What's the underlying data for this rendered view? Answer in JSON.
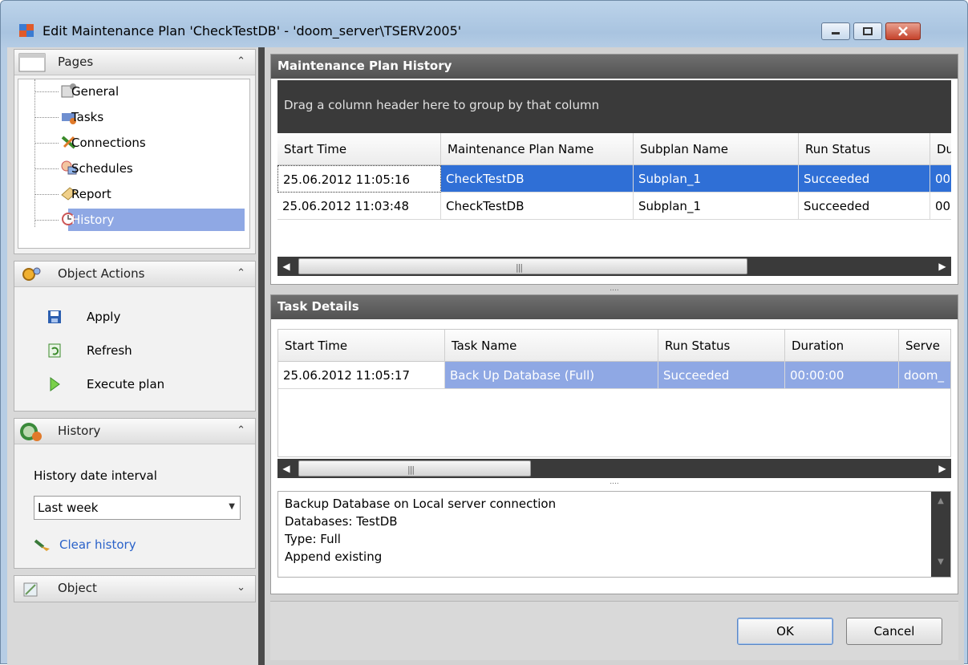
{
  "window": {
    "title": "Edit Maintenance Plan 'CheckTestDB' - 'doom_server\\TSERV2005'"
  },
  "left": {
    "pages_title": "Pages",
    "pages": [
      {
        "label": "General",
        "icon": "general-icon"
      },
      {
        "label": "Tasks",
        "icon": "tasks-icon"
      },
      {
        "label": "Connections",
        "icon": "connections-icon"
      },
      {
        "label": "Schedules",
        "icon": "schedules-icon"
      },
      {
        "label": "Report",
        "icon": "report-icon"
      },
      {
        "label": "History",
        "icon": "history-icon",
        "selected": true
      }
    ],
    "object_actions_title": "Object Actions",
    "actions": [
      {
        "label": "Apply",
        "icon": "save-icon"
      },
      {
        "label": "Refresh",
        "icon": "refresh-icon"
      },
      {
        "label": "Execute plan",
        "icon": "play-icon"
      }
    ],
    "history_title": "History",
    "history_interval_label": "History date interval",
    "history_interval_value": "Last week",
    "clear_history": "Clear history",
    "object_title": "Object"
  },
  "history_panel": {
    "title": "Maintenance Plan History",
    "group_hint": "Drag a column header here to group by that column",
    "columns": [
      "Start Time",
      "Maintenance Plan Name",
      "Subplan Name",
      "Run Status",
      "Du"
    ],
    "rows": [
      [
        "25.06.2012 11:05:16",
        "CheckTestDB",
        "Subplan_1",
        "Succeeded",
        "00"
      ],
      [
        "25.06.2012 11:03:48",
        "CheckTestDB",
        "Subplan_1",
        "Succeeded",
        "00"
      ]
    ]
  },
  "task_panel": {
    "title": "Task Details",
    "columns": [
      "Start Time",
      "Task Name",
      "Run Status",
      "Duration",
      "Serve"
    ],
    "rows": [
      [
        "25.06.2012 11:05:17",
        "Back Up Database (Full)",
        "Succeeded",
        "00:00:00",
        "doom_"
      ]
    ],
    "details": [
      "Backup Database on Local server connection",
      "Databases: TestDB",
      "Type: Full",
      "Append existing"
    ]
  },
  "footer": {
    "ok": "OK",
    "cancel": "Cancel"
  },
  "colors": {
    "selection_blue": "#2f6fd6",
    "selection_light": "#8fa8e4",
    "link": "#2a62c9"
  }
}
